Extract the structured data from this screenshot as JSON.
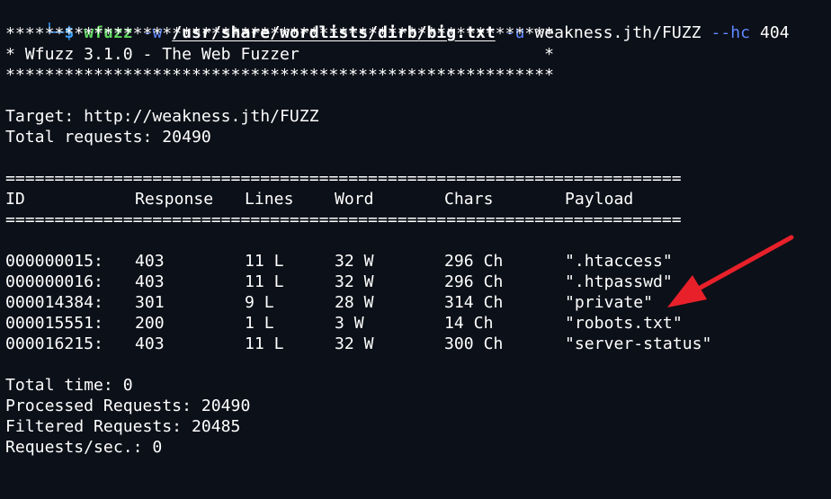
{
  "command": {
    "corner": "└─",
    "dollar": "$",
    "program": "wfuzz",
    "flag_w": "-w",
    "wordlist": "/usr/share/wordlists/dirb/big.txt",
    "flag_u": "-u",
    "url": "weakness.jth/FUZZ",
    "flag_hc": "--hc",
    "hc_value": "404"
  },
  "banner": {
    "border": "********************************************************",
    "title": "* Wfuzz 3.1.0 - The Web Fuzzer                         *"
  },
  "info": {
    "target": "Target: http://weakness.jth/FUZZ",
    "total_requests": "Total requests: 20490"
  },
  "table": {
    "rule": "=====================================================================",
    "headers": [
      "ID",
      "Response",
      "Lines",
      "Word",
      "Chars",
      "Payload"
    ],
    "rows": [
      [
        "000000015:",
        "403",
        "11 L",
        "32 W",
        "296 Ch",
        "\".htaccess\""
      ],
      [
        "000000016:",
        "403",
        "11 L",
        "32 W",
        "296 Ch",
        "\".htpasswd\""
      ],
      [
        "000014384:",
        "301",
        "9 L",
        "28 W",
        "314 Ch",
        "\"private\""
      ],
      [
        "000015551:",
        "200",
        "1 L",
        "3 W",
        "14 Ch",
        "\"robots.txt\""
      ],
      [
        "000016215:",
        "403",
        "11 L",
        "32 W",
        "300 Ch",
        "\"server-status\""
      ]
    ]
  },
  "summary": {
    "total_time": "Total time: 0",
    "processed": "Processed Requests: 20490",
    "filtered": "Filtered Requests: 20485",
    "rate": "Requests/sec.: 0"
  },
  "colors": {
    "background": "#0c1018",
    "prompt": "#3aa0ff",
    "command": "#5fd75f",
    "flag": "#5f87ff",
    "annotation_arrow": "#e8202a"
  },
  "annotation": {
    "icon": "red-arrow-icon"
  }
}
